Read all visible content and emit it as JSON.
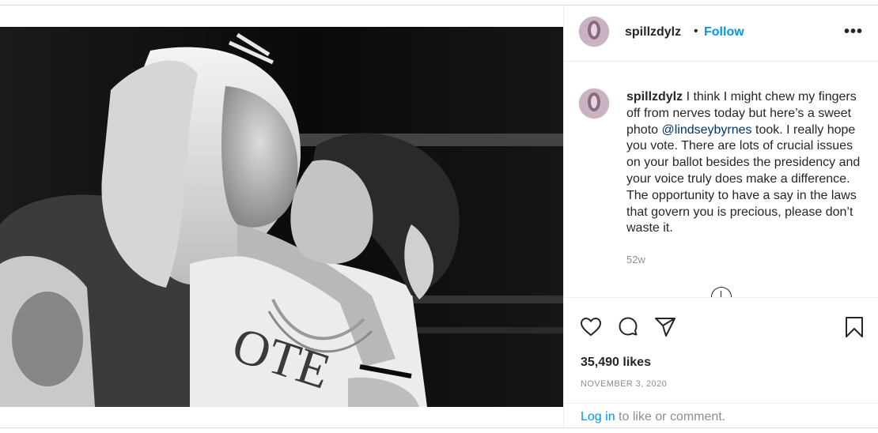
{
  "post": {
    "username": "spillzdylz",
    "follow_label": "Follow",
    "separator": "•",
    "more_label": "•••",
    "photo_text": "OTE",
    "caption": {
      "username": "spillzdylz",
      "text_before": " I think I might chew my fingers off from nerves today but here’s a sweet photo ",
      "mention": "@lindseybyrnes",
      "text_after": " took. I really hope you vote. There are lots of crucial issues on your ballot besides the presidency and your voice truly does make a difference. The opportunity to have a say in the laws that govern you is precious, please don’t waste it."
    },
    "timestamp": "52w",
    "likes": "35,490 likes",
    "date": "NOVEMBER 3, 2020",
    "login": {
      "link_label": "Log in",
      "suffix": " to like or comment."
    }
  },
  "icons": {
    "like": "heart-icon",
    "comment": "comment-bubble-icon",
    "share": "paper-plane-icon",
    "save": "bookmark-icon",
    "load_more": "plus-circle-icon",
    "more": "ellipsis-icon"
  },
  "colors": {
    "accent": "#0095f6",
    "mention": "#00376b",
    "muted": "#8e8e8e",
    "text": "#262626",
    "border": "#dbdbdb"
  }
}
